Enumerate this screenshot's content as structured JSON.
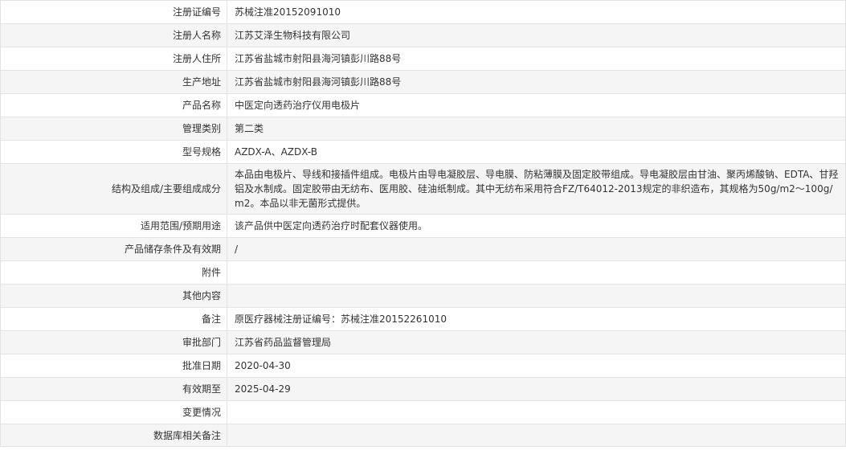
{
  "rows": [
    {
      "label": "注册证编号",
      "value": "苏械注准20152091010"
    },
    {
      "label": "注册人名称",
      "value": "江苏艾泽生物科技有限公司"
    },
    {
      "label": "注册人住所",
      "value": "江苏省盐城市射阳县海河镇彭川路88号"
    },
    {
      "label": "生产地址",
      "value": "江苏省盐城市射阳县海河镇彭川路88号"
    },
    {
      "label": "产品名称",
      "value": "中医定向透药治疗仪用电极片"
    },
    {
      "label": "管理类别",
      "value": "第二类"
    },
    {
      "label": "型号规格",
      "value": "AZDX-A、AZDX-B"
    },
    {
      "label": "结构及组成/主要组成成分",
      "value": "本品由电极片、导线和接插件组成。电极片由导电凝胶层、导电膜、防粘薄膜及固定胶带组成。导电凝胶层由甘油、聚丙烯酸钠、EDTA、甘羟铝及水制成。固定胶带由无纺布、医用胶、硅油纸制成。其中无纺布采用符合FZ/T64012-2013规定的非织造布，其规格为50g/m2～100g/m2。本品以非无菌形式提供。"
    },
    {
      "label": "适用范围/预期用途",
      "value": "该产品供中医定向透药治疗时配套仪器使用。"
    },
    {
      "label": "产品储存条件及有效期",
      "value": "/"
    },
    {
      "label": "附件",
      "value": ""
    },
    {
      "label": "其他内容",
      "value": ""
    },
    {
      "label": "备注",
      "value": "原医疗器械注册证编号：苏械注准20152261010"
    },
    {
      "label": "审批部门",
      "value": "江苏省药品监督管理局"
    },
    {
      "label": "批准日期",
      "value": "2020-04-30"
    },
    {
      "label": "有效期至",
      "value": "2025-04-29"
    },
    {
      "label": "变更情况",
      "value": ""
    },
    {
      "label": "数据库相关备注",
      "value": ""
    }
  ]
}
